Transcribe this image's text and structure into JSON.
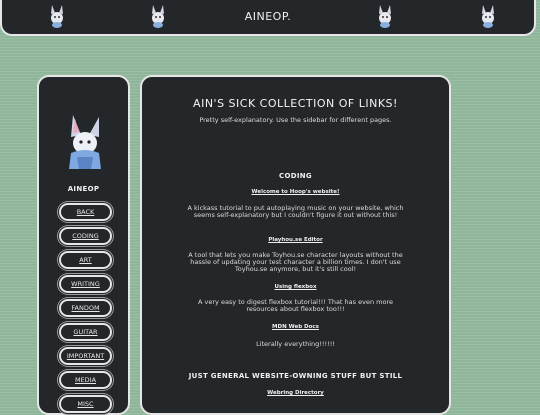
{
  "header": {
    "title": "AINEOP.",
    "icons": [
      "bunny-icon",
      "bunny-icon",
      "bunny-icon",
      "bunny-icon"
    ]
  },
  "sidebar": {
    "name": "AINEOP",
    "items": [
      {
        "label": "BACK"
      },
      {
        "label": "CODING"
      },
      {
        "label": "ART"
      },
      {
        "label": "WRITING"
      },
      {
        "label": "FANDOM"
      },
      {
        "label": "GUITAR"
      },
      {
        "label": "IMPORTANT"
      },
      {
        "label": "MEDIA"
      },
      {
        "label": "MISC"
      }
    ]
  },
  "main": {
    "title": "AIN'S SICK COLLECTION OF LINKS!",
    "subtitle": "Pretty self-explanatory. Use the sidebar for different pages.",
    "sections": [
      {
        "heading": "CODING",
        "links": [
          {
            "title": "Welcome to Hoop's website!",
            "desc": "A kickass tutorial to put autoplaying music on your website, which seems self-explanatory but I couldn't figure it out without this!"
          },
          {
            "title": "Playhou.se Editor",
            "desc": "A tool that lets you make Toyhou.se character layouts without the hassle of updating your test character a billion times. I don't use Toyhou.se anymore, but it's still cool!"
          },
          {
            "title": "Using flexbox",
            "desc": "A very easy to digest flexbox tutorial!!! That has even more resources about flexbox too!!!"
          },
          {
            "title": "MDN Web Docs",
            "desc": "Literally everything!!!!!!"
          }
        ]
      },
      {
        "heading": "JUST GENERAL WEBSITE-OWNING STUFF BUT STILL",
        "links": [
          {
            "title": "Webring Directory",
            "desc": ""
          }
        ]
      }
    ]
  },
  "colors": {
    "background": "#8fb59a",
    "panel": "#23272a",
    "border": "#e6e6e6"
  }
}
